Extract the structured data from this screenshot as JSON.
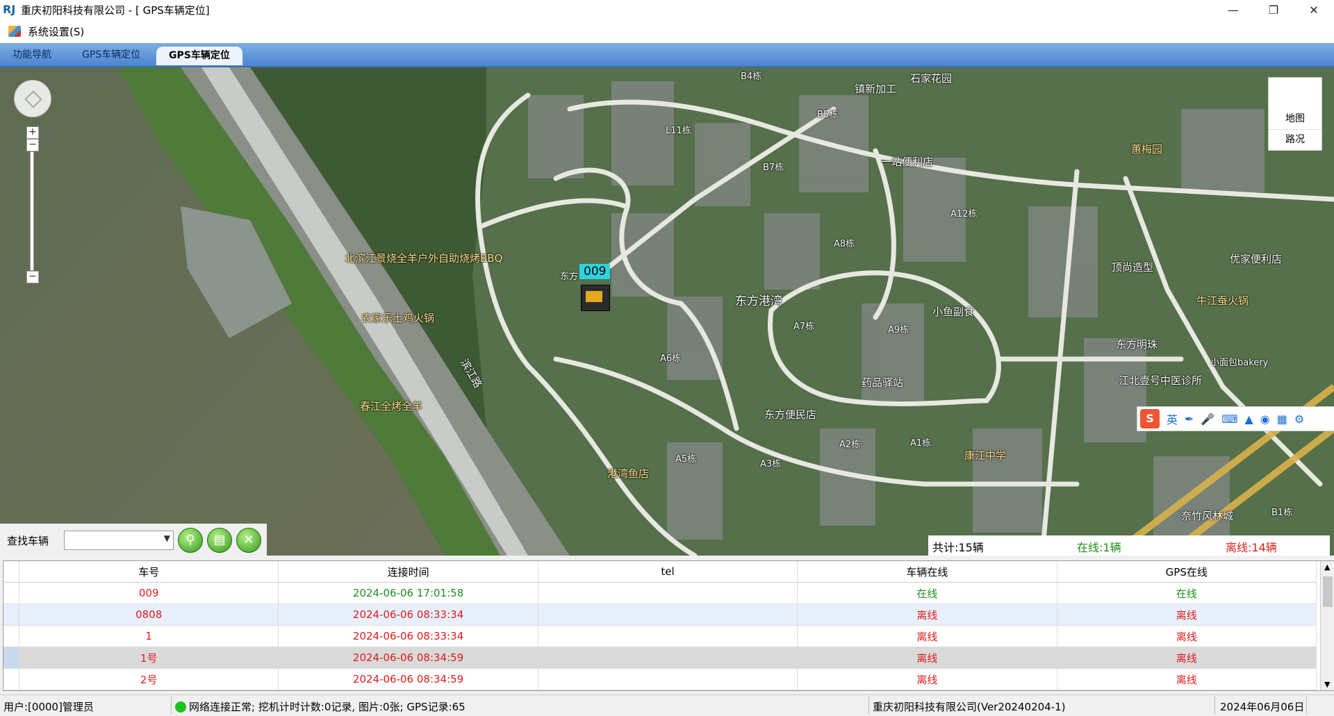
{
  "window": {
    "title": "重庆初阳科技有限公司 - [ GPS车辆定位]",
    "app_icon": "RJ",
    "controls": [
      "minimize-icon",
      "restore-icon",
      "close-icon"
    ]
  },
  "menu": {
    "items": [
      "系统设置(S)"
    ]
  },
  "tabs": [
    {
      "label": "功能导航"
    },
    {
      "label": "GPS车辆定位"
    },
    {
      "label": "GPS车辆定位",
      "active": true
    }
  ],
  "map": {
    "type_buttons": {
      "map": "地图",
      "traffic": "路况"
    },
    "labels": {
      "shishi": "石家花园",
      "shenzhen": "镇新加工",
      "b4": "B4栋",
      "b5": "B5栋",
      "l11": "L11栋",
      "b7": "B7栋",
      "yizhan": "一站便利店",
      "a12": "A12栋",
      "a8": "A8栋",
      "dongfang_gangwan": "东方港湾",
      "a7": "A7栋",
      "a9": "A9栋",
      "xiaoyu": "小鱼副食",
      "a6": "A6栋",
      "yaozhan": "药品驿站",
      "dongfang_bianmin": "东方便民店",
      "a5": "A5栋",
      "a3": "A3栋",
      "a2": "A2栋",
      "a1": "A1栋",
      "gangwan_yudian": "港湾鱼店",
      "huiying": "蕙梅园",
      "beibin": "北滨江景烧全羊户外自助烧烤BBQ",
      "nongjia": "农家乐土鸡火锅",
      "chunjiang": "春江全烤全羊",
      "dongfang_mingzhu": "东方明珠",
      "dingshang": "顶尚造型",
      "kangjiang": "康江中学",
      "niujiang": "牛江蚕火锅",
      "youjia": "优家便利店",
      "jiangbei": "江北壹号中医诊所",
      "bakery": "小面包bakery",
      "b1": "B1栋",
      "fenglin": "奈竹风林城",
      "nanjing_road": "滨江路",
      "vehicle_side": "东方"
    }
  },
  "vehicle_marker": {
    "label": "009"
  },
  "ime_bar": {
    "logo": "S",
    "lang": "英",
    "icons": [
      "pen-icon",
      "mic-icon",
      "keyboard-icon",
      "shirt-icon",
      "game-icon",
      "grid-icon",
      "settings-icon"
    ]
  },
  "search": {
    "label": "查找车辆",
    "selected": "",
    "buttons": [
      "search-icon",
      "doc-icon",
      "clear-icon"
    ]
  },
  "stats": {
    "total": "共计:15辆",
    "online": "在线:1辆",
    "offline": "离线:14辆"
  },
  "table": {
    "columns": [
      "车号",
      "连接时间",
      "tel",
      "车辆在线",
      "GPS在线"
    ],
    "rows": [
      {
        "car": "009",
        "time": "2024-06-06 17:01:58",
        "tel": "",
        "vehicle": "在线",
        "gps": "在线"
      },
      {
        "car": "0808",
        "time": "2024-06-06 08:33:34",
        "tel": "",
        "vehicle": "离线",
        "gps": "离线"
      },
      {
        "car": "1",
        "time": "2024-06-06 08:33:34",
        "tel": "",
        "vehicle": "离线",
        "gps": "离线"
      },
      {
        "car": "1号",
        "time": "2024-06-06 08:34:59",
        "tel": "",
        "vehicle": "离线",
        "gps": "离线"
      },
      {
        "car": "2号",
        "time": "2024-06-06 08:34:59",
        "tel": "",
        "vehicle": "离线",
        "gps": "离线"
      }
    ]
  },
  "statusbar": {
    "user": "用户:[0000]管理员",
    "network": "网络连接正常; 挖机计时计数:0记录, 图片:0张; GPS记录:65",
    "company": "重庆初阳科技有限公司(Ver20240204-1)",
    "date": "2024年06月06日"
  },
  "colors": {
    "online": "#1a8f1a",
    "offline": "#e01b1b",
    "tab_bar": "#4c84cf",
    "vehicle_label": "#2ad4e0"
  }
}
